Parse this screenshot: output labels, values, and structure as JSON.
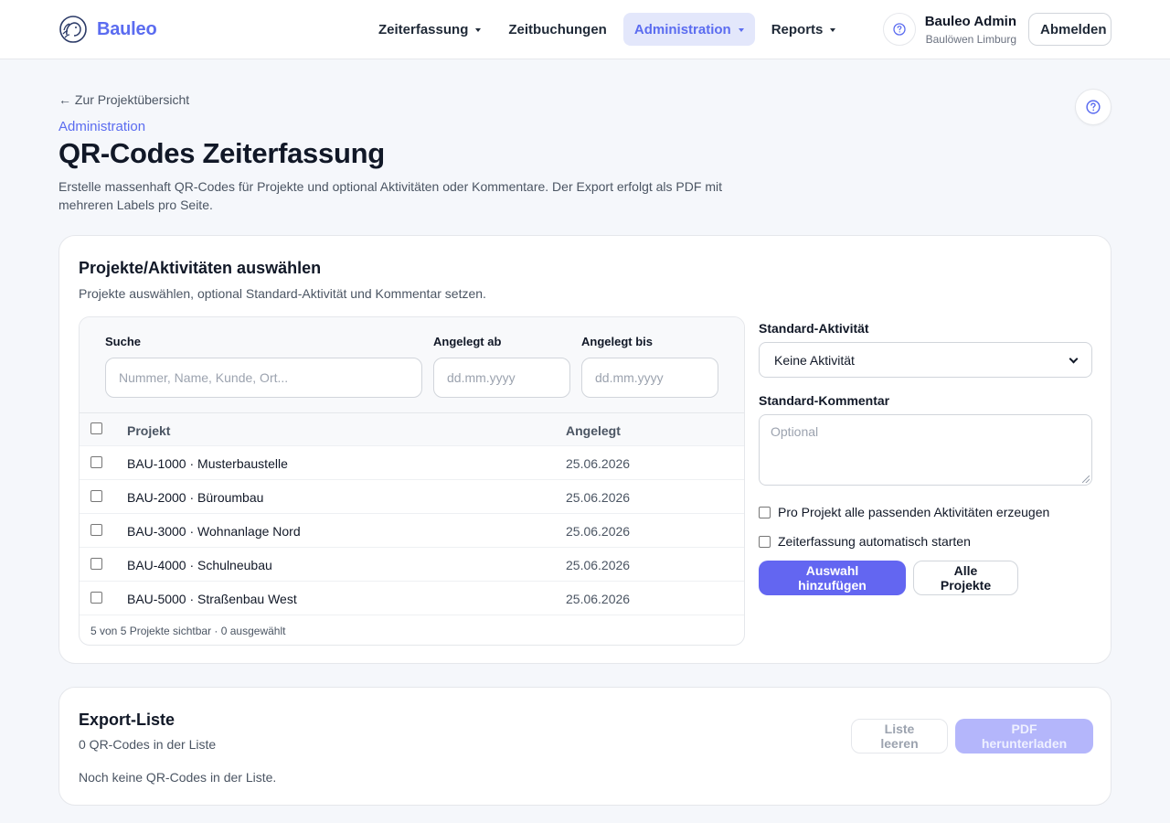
{
  "header": {
    "brand": "Bauleo",
    "nav": [
      {
        "label": "Zeiterfassung",
        "has_menu": true,
        "active": false
      },
      {
        "label": "Zeitbuchungen",
        "has_menu": false,
        "active": false
      },
      {
        "label": "Administration",
        "has_menu": true,
        "active": true
      },
      {
        "label": "Reports",
        "has_menu": true,
        "active": false
      }
    ],
    "help_icon": "question-circle-icon",
    "user_name": "Bauleo Admin",
    "user_org": "Baulöwen Limburg",
    "logout_label": "Abmelden"
  },
  "colors": {
    "accent": "#5b6cf0",
    "primary_button": "#6366f1",
    "active_nav_bg": "#e3e7fb"
  },
  "page": {
    "back_link": "← Zur Projektübersicht",
    "eyebrow": "Administration",
    "title": "QR-Codes Zeiterfassung",
    "description": "Erstelle massenhaft QR-Codes für Projekte und optional Aktivitäten oder Kommentare. Der Export erfolgt als PDF mit mehreren Labels pro Seite."
  },
  "selection": {
    "title": "Projekte/Aktivitäten auswählen",
    "subtitle": "Projekte auswählen, optional Standard-Aktivität und Kommentar setzen.",
    "filters": {
      "search_label": "Suche",
      "search_placeholder": "Nummer, Name, Kunde, Ort...",
      "from_label": "Angelegt ab",
      "from_placeholder": "dd.mm.yyyy",
      "to_label": "Angelegt bis",
      "to_placeholder": "dd.mm.yyyy"
    },
    "table": {
      "col_project": "Projekt",
      "col_created": "Angelegt",
      "rows": [
        {
          "project": "BAU-1000 · Musterbaustelle",
          "created": "25.06.2026"
        },
        {
          "project": "BAU-2000 · Büroumbau",
          "created": "25.06.2026"
        },
        {
          "project": "BAU-3000 · Wohnanlage Nord",
          "created": "25.06.2026"
        },
        {
          "project": "BAU-4000 · Schulneubau",
          "created": "25.06.2026"
        },
        {
          "project": "BAU-5000 · Straßenbau West",
          "created": "25.06.2026"
        }
      ],
      "footer": "5 von 5 Projekte sichtbar · 0 ausgewählt"
    },
    "default_activity_label": "Standard-Aktivität",
    "default_activity_value": "Keine Aktivität",
    "default_comment_label": "Standard-Kommentar",
    "default_comment_placeholder": "Optional",
    "option_all_activities": "Pro Projekt alle passenden Aktivitäten erzeugen",
    "option_autostart": "Zeiterfassung automatisch starten",
    "add_button": "Auswahl hinzufügen",
    "all_projects_button": "Alle Projekte"
  },
  "export": {
    "title": "Export-Liste",
    "count_text": "0 QR-Codes in der Liste",
    "empty_text": "Noch keine QR-Codes in der Liste.",
    "clear_button": "Liste leeren",
    "download_button": "PDF herunterladen"
  }
}
